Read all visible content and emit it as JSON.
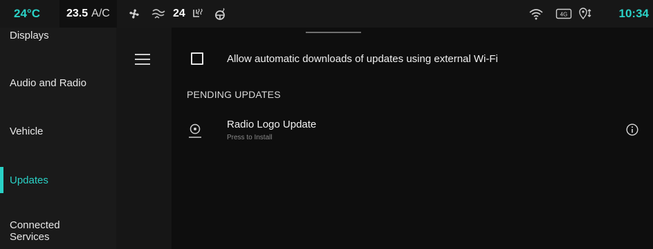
{
  "status_bar": {
    "outside_temp": "24°C",
    "ac_temp": "23.5",
    "ac_label": "A/C",
    "fan_level": "24",
    "clock": "10:34",
    "icons": [
      "fan-icon",
      "airflow-icon",
      "seat-heat-icon",
      "steering-heat-icon",
      "wifi-icon",
      "lte-icon",
      "location-icon"
    ],
    "lte_label": "4G"
  },
  "sidebar": {
    "items": [
      {
        "label": "Displays",
        "active": false
      },
      {
        "label": "Audio and Radio",
        "active": false
      },
      {
        "label": "Vehicle",
        "active": false
      },
      {
        "label": "Updates",
        "active": true
      },
      {
        "label": "Connected Services",
        "active": false
      }
    ],
    "menu_icon": "hamburger-menu-icon"
  },
  "main": {
    "auto_download": {
      "label": "Allow automatic downloads of updates using external Wi-Fi",
      "checked": false
    },
    "pending_title": "PENDING UPDATES",
    "updates": [
      {
        "title": "Radio Logo Update",
        "subtitle": "Press to Install",
        "icon": "install-icon",
        "info_icon": "info-icon"
      }
    ]
  },
  "colors": {
    "accent": "#2ad1c6",
    "background": "#0e0e0e",
    "sidebar": "#1a1a1a",
    "statusbar": "#171717"
  }
}
